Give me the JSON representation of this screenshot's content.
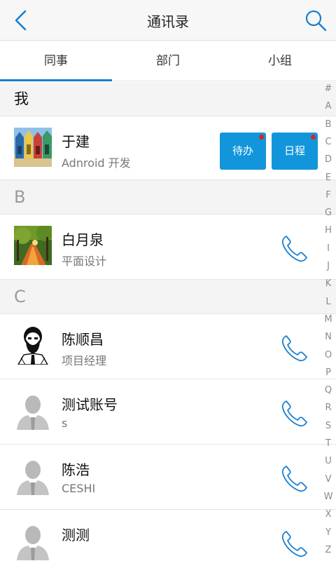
{
  "header": {
    "title": "通讯录"
  },
  "tabs": [
    {
      "label": "同事",
      "active": true
    },
    {
      "label": "部门",
      "active": false
    },
    {
      "label": "小组",
      "active": false
    }
  ],
  "me_section": {
    "header": "我"
  },
  "me": {
    "name": "于建",
    "subtitle": "Adnroid 开发",
    "todo_label": "待办",
    "schedule_label": "日程"
  },
  "sections": [
    {
      "letter": "B",
      "contacts": [
        {
          "name": "白月泉",
          "subtitle": "平面设计"
        }
      ]
    },
    {
      "letter": "C",
      "contacts": [
        {
          "name": "陈顺昌",
          "subtitle": "项目经理"
        },
        {
          "name": "测试账号",
          "subtitle": "s"
        },
        {
          "name": "陈浩",
          "subtitle": "CESHI"
        },
        {
          "name": "测测",
          "subtitle": ""
        }
      ]
    }
  ],
  "index_letters": [
    "#",
    "A",
    "B",
    "C",
    "D",
    "E",
    "F",
    "G",
    "H",
    "I",
    "J",
    "K",
    "L",
    "M",
    "N",
    "O",
    "P",
    "Q",
    "R",
    "S",
    "T",
    "U",
    "V",
    "W",
    "X",
    "Y",
    "Z"
  ],
  "colors": {
    "accent": "#1296db",
    "tab_underline": "#1a7fcf",
    "badge": "#e02020"
  }
}
